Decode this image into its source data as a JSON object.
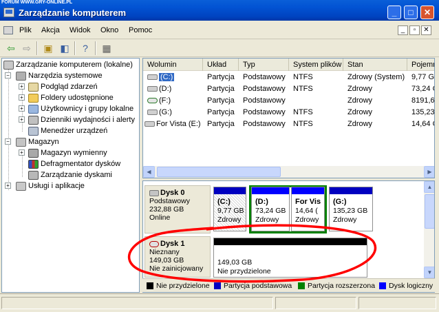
{
  "window": {
    "title": "Zarządzanie komputerem",
    "watermark": "FORUM  WWW.GRY-ONLINE.PL"
  },
  "menu": [
    "Plik",
    "Akcja",
    "Widok",
    "Okno",
    "Pomoc"
  ],
  "tree": [
    {
      "label": "Zarządzanie komputerem (lokalne)",
      "level": 0,
      "icon": "computer-icon",
      "exp": ""
    },
    {
      "label": "Narzędzia systemowe",
      "level": 1,
      "icon": "tools-icon",
      "exp": "-"
    },
    {
      "label": "Podgląd zdarzeń",
      "level": 2,
      "icon": "event-viewer-icon",
      "exp": "+"
    },
    {
      "label": "Foldery udostępnione",
      "level": 2,
      "icon": "shared-folder-icon",
      "exp": "+"
    },
    {
      "label": "Użytkownicy i grupy lokalne",
      "level": 2,
      "icon": "users-icon",
      "exp": "+"
    },
    {
      "label": "Dzienniki wydajności i alerty",
      "level": 2,
      "icon": "performance-icon",
      "exp": "+"
    },
    {
      "label": "Menedżer urządzeń",
      "level": 2,
      "icon": "device-manager-icon",
      "exp": ""
    },
    {
      "label": "Magazyn",
      "level": 1,
      "icon": "storage-icon",
      "exp": "-"
    },
    {
      "label": "Magazyn wymienny",
      "level": 2,
      "icon": "removable-storage-icon",
      "exp": "+"
    },
    {
      "label": "Defragmentator dysków",
      "level": 2,
      "icon": "defrag-icon",
      "exp": ""
    },
    {
      "label": "Zarządzanie dyskami",
      "level": 2,
      "icon": "disk-management-icon",
      "exp": ""
    },
    {
      "label": "Usługi i aplikacje",
      "level": 1,
      "icon": "services-icon",
      "exp": "+"
    }
  ],
  "volumes": {
    "headers": [
      "Wolumin",
      "Układ",
      "Typ",
      "System plików",
      "Stan",
      "Pojemn"
    ],
    "rows": [
      [
        "(C:)",
        "Partycja",
        "Podstawowy",
        "NTFS",
        "Zdrowy (System)",
        "9,77 G"
      ],
      [
        "(D:)",
        "Partycja",
        "Podstawowy",
        "NTFS",
        "Zdrowy",
        "73,24 G"
      ],
      [
        "(F:)",
        "Partycja",
        "Podstawowy",
        "",
        "Zdrowy",
        "8191,6"
      ],
      [
        "(G:)",
        "Partycja",
        "Podstawowy",
        "NTFS",
        "Zdrowy",
        "135,23"
      ],
      [
        "For Vista (E:)",
        "Partycja",
        "Podstawowy",
        "NTFS",
        "Zdrowy",
        "14,64 G"
      ]
    ]
  },
  "disks": [
    {
      "name": "Dysk 0",
      "type": "Podstawowy",
      "size": "232,88 GB",
      "status": "Online",
      "partitions": [
        {
          "label": "(C:)",
          "size": "9,77 GB",
          "status": "Zdrowy"
        },
        {
          "label": "(D:)",
          "size": "73,24 GB",
          "status": "Zdrowy"
        },
        {
          "label": "For Vis",
          "size": "14,64 (",
          "status": "Zdrowy"
        },
        {
          "label": "(G:)",
          "size": "135,23 GB",
          "status": "Zdrowy"
        }
      ]
    },
    {
      "name": "Dysk 1",
      "type": "Nieznany",
      "size": "149,03 GB",
      "status": "Nie zainicjowany",
      "partitions": [
        {
          "label": "",
          "size": "149,03 GB",
          "status": "Nie przydzielone"
        }
      ]
    }
  ],
  "legend": [
    {
      "label": "Nie przydzielone",
      "color": "#000000"
    },
    {
      "label": "Partycja podstawowa",
      "color": "#0000c0"
    },
    {
      "label": "Partycja rozszerzona",
      "color": "#008000"
    },
    {
      "label": "Dysk logiczny",
      "color": "#0000ff"
    }
  ],
  "colors": {
    "primary_bar": "#0000c0",
    "logical_bar": "#0000ff",
    "extended_frame": "#008000",
    "unallocated_bar": "#000000",
    "annotation": "#ff0000",
    "selection": "#316ac5"
  }
}
